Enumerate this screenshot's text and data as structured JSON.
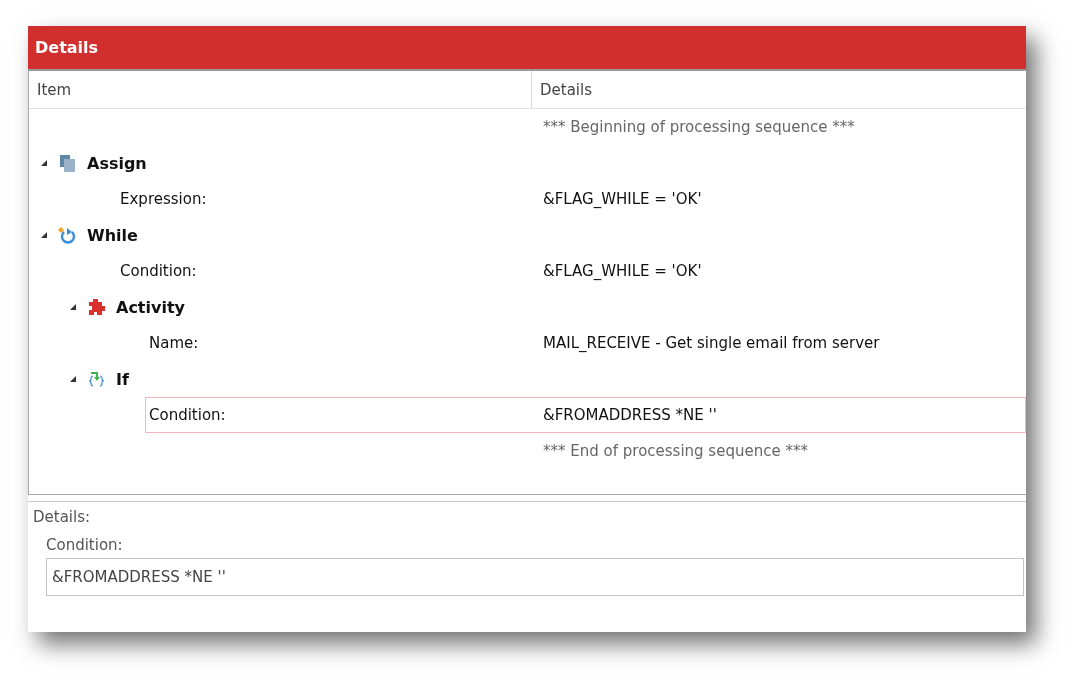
{
  "panel": {
    "title": "Details"
  },
  "table": {
    "columns": [
      "Item",
      "Details"
    ],
    "rows": [
      {
        "kind": "marker",
        "details": "*** Beginning of processing sequence ***"
      },
      {
        "kind": "assign",
        "label": "Assign",
        "expanded": true,
        "children": [
          {
            "kind": "property",
            "label": "Expression:",
            "details": "&FLAG_WHILE = 'OK'",
            "selected": false
          }
        ]
      },
      {
        "kind": "while",
        "label": "While",
        "expanded": true,
        "children": [
          {
            "kind": "property",
            "label": "Condition:",
            "details": "&FLAG_WHILE = 'OK'",
            "selected": false
          },
          {
            "kind": "activity",
            "label": "Activity",
            "expanded": true,
            "children": [
              {
                "kind": "property",
                "label": "Name:",
                "details": "MAIL_RECEIVE - Get single email from server",
                "selected": false
              }
            ]
          },
          {
            "kind": "if",
            "label": "If",
            "expanded": true,
            "children": [
              {
                "kind": "property",
                "label": "Condition:",
                "details": "&FROMADDRESS *NE ''",
                "selected": true
              }
            ]
          }
        ]
      },
      {
        "kind": "marker",
        "details": "*** End of processing sequence ***"
      }
    ]
  },
  "details_pane": {
    "label": "Details:",
    "field_label": "Condition:",
    "value": "&FROMADDRESS *NE ''"
  }
}
